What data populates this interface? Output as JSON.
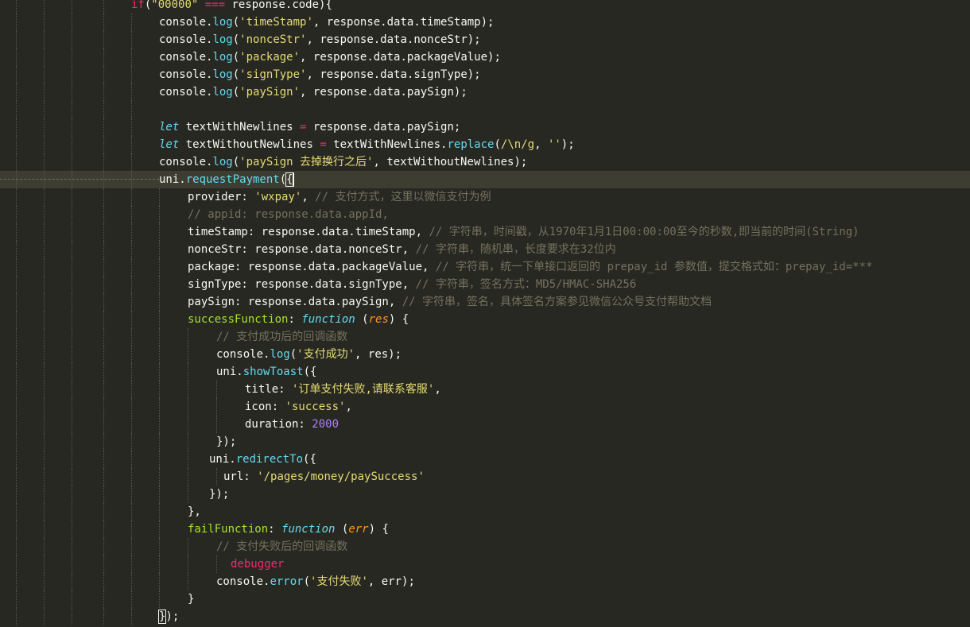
{
  "editor": {
    "colors": {
      "background": "#272822",
      "current_line": "#3e3d32",
      "text": "#f8f8f2",
      "keyword": "#f92672",
      "storage": "#66d9ef",
      "string": "#e6db74",
      "function": "#66d9ef",
      "property": "#a6e22e",
      "parameter": "#fd971f",
      "number": "#ae81ff",
      "comment": "#75715e"
    },
    "lines": [
      [
        [
          "kw",
          "if"
        ],
        [
          "plain",
          "("
        ],
        [
          "str",
          "\"00000\""
        ],
        [
          "kw",
          " === "
        ],
        [
          "plain",
          "response.code){"
        ]
      ],
      [
        [
          "plain",
          "console."
        ],
        [
          "fn",
          "log"
        ],
        [
          "plain",
          "("
        ],
        [
          "str",
          "'timeStamp'"
        ],
        [
          "plain",
          ", response.data.timeStamp);"
        ]
      ],
      [
        [
          "plain",
          "console."
        ],
        [
          "fn",
          "log"
        ],
        [
          "plain",
          "("
        ],
        [
          "str",
          "'nonceStr'"
        ],
        [
          "plain",
          ", response.data.nonceStr);"
        ]
      ],
      [
        [
          "plain",
          "console."
        ],
        [
          "fn",
          "log"
        ],
        [
          "plain",
          "("
        ],
        [
          "str",
          "'package'"
        ],
        [
          "plain",
          ", response.data.packageValue);"
        ]
      ],
      [
        [
          "plain",
          "console."
        ],
        [
          "fn",
          "log"
        ],
        [
          "plain",
          "("
        ],
        [
          "str",
          "'signType'"
        ],
        [
          "plain",
          ", response.data.signType);"
        ]
      ],
      [
        [
          "plain",
          "console."
        ],
        [
          "fn",
          "log"
        ],
        [
          "plain",
          "("
        ],
        [
          "str",
          "'paySign'"
        ],
        [
          "plain",
          ", response.data.paySign);"
        ]
      ],
      [],
      [
        [
          "kwi",
          "let"
        ],
        [
          "plain",
          " textWithNewlines "
        ],
        [
          "kw",
          "="
        ],
        [
          "plain",
          " response.data.paySign;"
        ]
      ],
      [
        [
          "kwi",
          "let"
        ],
        [
          "plain",
          " textWithoutNewlines "
        ],
        [
          "kw",
          "="
        ],
        [
          "plain",
          " textWithNewlines."
        ],
        [
          "fn",
          "replace"
        ],
        [
          "plain",
          "("
        ],
        [
          "str",
          "/\\n/g"
        ],
        [
          "plain",
          ", "
        ],
        [
          "str",
          "''"
        ],
        [
          "plain",
          ");"
        ]
      ],
      [
        [
          "plain",
          "console."
        ],
        [
          "fn",
          "log"
        ],
        [
          "plain",
          "("
        ],
        [
          "str",
          "'paySign 去掉换行之后'"
        ],
        [
          "plain",
          ", textWithoutNewlines);"
        ]
      ],
      [
        [
          "plain",
          "uni."
        ],
        [
          "fn",
          "requestPayment"
        ],
        [
          "plain",
          "("
        ],
        [
          "bracket",
          "{"
        ]
      ],
      [
        [
          "plain",
          "provider: "
        ],
        [
          "str",
          "'wxpay'"
        ],
        [
          "plain",
          ", "
        ],
        [
          "cmt",
          "// 支付方式，这里以微信支付为例"
        ]
      ],
      [
        [
          "cmt",
          "// appid: response.data.appId,"
        ]
      ],
      [
        [
          "plain",
          "timeStamp: response.data.timeStamp, "
        ],
        [
          "cmt",
          "// 字符串，时间戳，从1970年1月1日00:00:00至今的秒数,即当前的时间(String)"
        ]
      ],
      [
        [
          "plain",
          "nonceStr: response.data.nonceStr, "
        ],
        [
          "cmt",
          "// 字符串，随机串，长度要求在32位内"
        ]
      ],
      [
        [
          "plain",
          "package: response.data.packageValue, "
        ],
        [
          "cmt",
          "// 字符串，统一下单接口返回的 prepay_id 参数值，提交格式如：prepay_id=***"
        ]
      ],
      [
        [
          "plain",
          "signType: response.data.signType, "
        ],
        [
          "cmt",
          "// 字符串，签名方式：MD5/HMAC-SHA256"
        ]
      ],
      [
        [
          "plain",
          "paySign: response.data.paySign, "
        ],
        [
          "cmt",
          "// 字符串，签名，具体签名方案参见微信公众号支付帮助文档"
        ]
      ],
      [
        [
          "prop",
          "successFunction"
        ],
        [
          "plain",
          ": "
        ],
        [
          "kwi",
          "function"
        ],
        [
          "plain",
          " ("
        ],
        [
          "param",
          "res"
        ],
        [
          "plain",
          ") {"
        ]
      ],
      [
        [
          "cmt",
          "// 支付成功后的回调函数"
        ]
      ],
      [
        [
          "plain",
          "console."
        ],
        [
          "fn",
          "log"
        ],
        [
          "plain",
          "("
        ],
        [
          "str",
          "'支付成功'"
        ],
        [
          "plain",
          ", res);"
        ]
      ],
      [
        [
          "plain",
          "uni."
        ],
        [
          "fn",
          "showToast"
        ],
        [
          "plain",
          "({"
        ]
      ],
      [
        [
          "plain",
          "title: "
        ],
        [
          "str",
          "'订单支付失败,请联系客服'"
        ],
        [
          "plain",
          ","
        ]
      ],
      [
        [
          "plain",
          "icon: "
        ],
        [
          "str",
          "'success'"
        ],
        [
          "plain",
          ","
        ]
      ],
      [
        [
          "plain",
          "duration: "
        ],
        [
          "num",
          "2000"
        ]
      ],
      [
        [
          "plain",
          "});"
        ]
      ],
      [
        [
          "plain",
          "uni."
        ],
        [
          "fn",
          "redirectTo"
        ],
        [
          "plain",
          "({"
        ]
      ],
      [
        [
          "plain",
          "url: "
        ],
        [
          "str",
          "'/pages/money/paySuccess'"
        ]
      ],
      [
        [
          "plain",
          "});"
        ]
      ],
      [
        [
          "plain",
          "},"
        ]
      ],
      [
        [
          "prop",
          "failFunction"
        ],
        [
          "plain",
          ": "
        ],
        [
          "kwi",
          "function"
        ],
        [
          "plain",
          " ("
        ],
        [
          "param",
          "err"
        ],
        [
          "plain",
          ") {"
        ]
      ],
      [
        [
          "cmt",
          "// 支付失败后的回调函数"
        ]
      ],
      [
        [
          "kw",
          "debugger"
        ]
      ],
      [
        [
          "plain",
          "console."
        ],
        [
          "fn",
          "error"
        ],
        [
          "plain",
          "("
        ],
        [
          "str",
          "'支付失败'"
        ],
        [
          "plain",
          ", err);"
        ]
      ],
      [
        [
          "plain",
          "}"
        ]
      ],
      [
        [
          "plain",
          ""
        ],
        [
          "bracket",
          "}"
        ],
        [
          "plain",
          ");"
        ]
      ]
    ]
  }
}
